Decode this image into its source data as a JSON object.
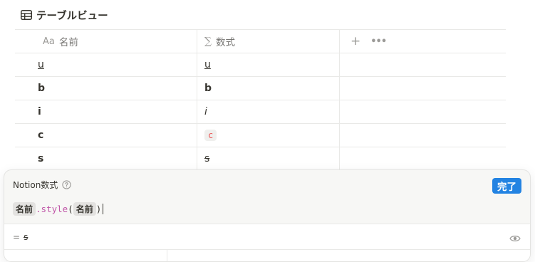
{
  "view": {
    "title": "テーブルビュー",
    "icon": "table-icon"
  },
  "table": {
    "columns": [
      {
        "icon_text": "Aa",
        "label": "名前"
      },
      {
        "icon_text": "∑",
        "label": "数式"
      }
    ],
    "add_icon": "+",
    "more_icon": "•••",
    "rows": [
      {
        "name": "u",
        "formula": "u"
      },
      {
        "name": "b",
        "formula": "b"
      },
      {
        "name": "i",
        "formula": "i"
      },
      {
        "name": "c",
        "formula": "c"
      },
      {
        "name": "s",
        "formula": "s"
      }
    ]
  },
  "editor": {
    "title": "Notion数式",
    "help_icon": "question-circle-icon",
    "done_label": "完了",
    "formula": {
      "prop_a": "名前",
      "method": ".style",
      "open": "(",
      "prop_b": "名前",
      "close": ")"
    },
    "result_prefix": "=",
    "result_value": "s",
    "eye_icon": "eye-icon"
  },
  "colors": {
    "accent": "#2383e2",
    "code_red": "#eb5757",
    "function": "#c056a8"
  }
}
